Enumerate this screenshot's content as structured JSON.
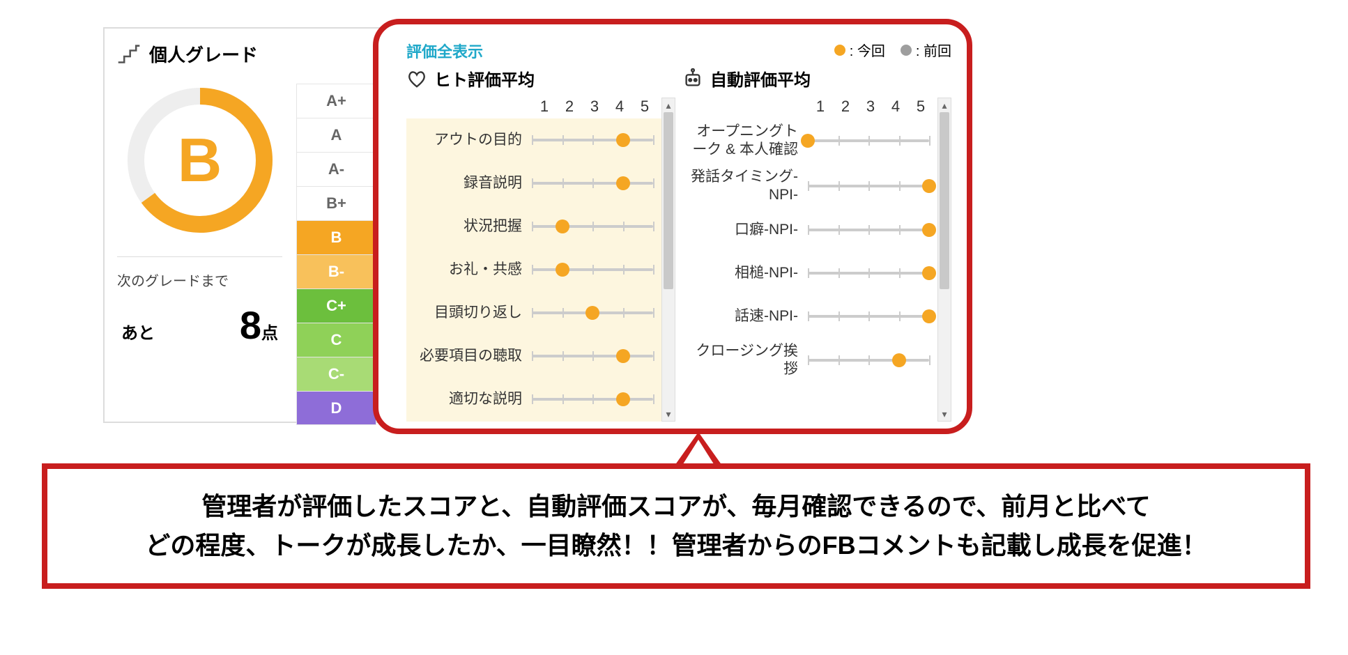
{
  "grade_card": {
    "title": "個人グレード",
    "grade_letter": "B",
    "progress_percent": 65,
    "next_label": "次のグレードまで",
    "remaining_word": "あと",
    "remaining_points_num": "8",
    "remaining_points_unit": "点",
    "ladder": [
      {
        "label": "A+",
        "class": ""
      },
      {
        "label": "A",
        "class": ""
      },
      {
        "label": "A-",
        "class": ""
      },
      {
        "label": "B+",
        "class": ""
      },
      {
        "label": "B",
        "class": "b"
      },
      {
        "label": "B-",
        "class": "bminus"
      },
      {
        "label": "C+",
        "class": "cplus"
      },
      {
        "label": "C",
        "class": "c"
      },
      {
        "label": "C-",
        "class": "cminus"
      },
      {
        "label": "D",
        "class": "d"
      }
    ]
  },
  "eval_panel": {
    "show_all_link": "評価全表示",
    "legend_now": ": 今回",
    "legend_prev": ": 前回",
    "scale_labels": [
      "1",
      "2",
      "3",
      "4",
      "5"
    ],
    "human": {
      "title": "ヒト評価平均",
      "items": [
        {
          "label": "アウトの目的",
          "value": 4
        },
        {
          "label": "録音説明",
          "value": 4
        },
        {
          "label": "状況把握",
          "value": 2
        },
        {
          "label": "お礼・共感",
          "value": 2
        },
        {
          "label": "目頭切り返し",
          "value": 3
        },
        {
          "label": "必要項目の聴取",
          "value": 4
        },
        {
          "label": "適切な説明",
          "value": 4
        }
      ]
    },
    "auto": {
      "title": "自動評価平均",
      "items": [
        {
          "label": "オープニングトーク & 本人確認",
          "value": 1
        },
        {
          "label": "発話タイミング-NPI-",
          "value": 5
        },
        {
          "label": "口癖-NPI-",
          "value": 5
        },
        {
          "label": "相槌-NPI-",
          "value": 5
        },
        {
          "label": "話速-NPI-",
          "value": 5
        },
        {
          "label": "クロージング挨拶",
          "value": 4
        }
      ]
    }
  },
  "callout": {
    "line1": "管理者が評価したスコアと、自動評価スコアが、毎月確認できるので、前月と比べて",
    "line2": "どの程度、トークが成長したか、一目瞭然！！管理者からのFBコメントも記載し成長を促進！"
  },
  "chart_data": [
    {
      "type": "bar",
      "title": "ヒト評価平均",
      "orientation": "horizontal",
      "xlabel": "",
      "ylabel": "",
      "xlim": [
        1,
        5
      ],
      "categories": [
        "アウトの目的",
        "録音説明",
        "状況把握",
        "お礼・共感",
        "目頭切り返し",
        "必要項目の聴取",
        "適切な説明"
      ],
      "series": [
        {
          "name": "今回",
          "color": "#f5a623",
          "values": [
            4,
            4,
            2,
            2,
            3,
            4,
            4
          ]
        }
      ]
    },
    {
      "type": "bar",
      "title": "自動評価平均",
      "orientation": "horizontal",
      "xlabel": "",
      "ylabel": "",
      "xlim": [
        1,
        5
      ],
      "categories": [
        "オープニングトーク & 本人確認",
        "発話タイミング-NPI-",
        "口癖-NPI-",
        "相槌-NPI-",
        "話速-NPI-",
        "クロージング挨拶"
      ],
      "series": [
        {
          "name": "今回",
          "color": "#f5a623",
          "values": [
            1,
            5,
            5,
            5,
            5,
            4
          ]
        }
      ]
    }
  ]
}
